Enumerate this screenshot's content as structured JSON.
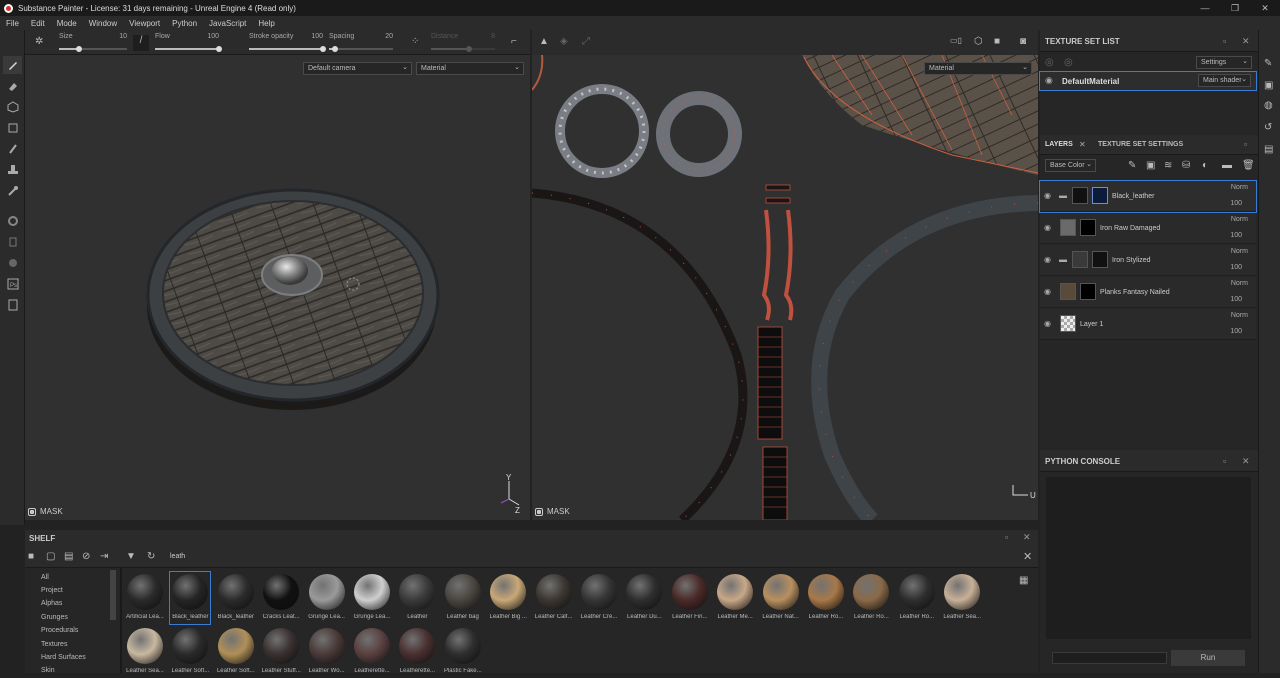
{
  "app": {
    "title": "Substance Painter - License: 31 days remaining - Unreal Engine 4 (Read only)"
  },
  "window_controls": {
    "minimize": "—",
    "restore": "❐",
    "close": "✕"
  },
  "menu": [
    "File",
    "Edit",
    "Mode",
    "Window",
    "Viewport",
    "Python",
    "JavaScript",
    "Help"
  ],
  "brush_params": {
    "size": {
      "label": "Size",
      "value": "10",
      "fraction": 0.3
    },
    "flow": {
      "label": "Flow",
      "value": "100",
      "fraction": 1.0
    },
    "stroke_opacity": {
      "label": "Stroke opacity",
      "value": "100",
      "fraction": 1.0
    },
    "spacing": {
      "label": "Spacing",
      "value": "20",
      "fraction": 0.1
    },
    "distance": {
      "label": "Distance",
      "value": "8",
      "fraction": 0.6
    }
  },
  "viewport3d": {
    "camera": "Default camera",
    "channel": "Material",
    "mask_label": "MASK",
    "axis_y": "Y",
    "axis_z": "Z"
  },
  "viewport2d": {
    "channel": "Material",
    "mask_label": "MASK",
    "axis_u": "U"
  },
  "texture_set_list": {
    "title": "TEXTURE SET LIST",
    "settings_label": "Settings",
    "item_name": "DefaultMaterial",
    "shader": "Main shader"
  },
  "layers_panel": {
    "tab_layers": "LAYERS",
    "tab_settings": "TEXTURE SET SETTINGS",
    "channel": "Base Color",
    "layers": [
      {
        "name": "Black_leather",
        "blend": "Norm",
        "opacity": "100",
        "selected": true,
        "folder": true
      },
      {
        "name": "Iron Raw Damaged",
        "blend": "Norm",
        "opacity": "100",
        "selected": false,
        "folder": false
      },
      {
        "name": "Iron Stylized",
        "blend": "Norm",
        "opacity": "100",
        "selected": false,
        "folder": true
      },
      {
        "name": "Planks Fantasy Nailed",
        "blend": "Norm",
        "opacity": "100",
        "selected": false,
        "folder": false
      },
      {
        "name": "Layer 1",
        "blend": "Norm",
        "opacity": "100",
        "selected": false,
        "folder": false
      }
    ]
  },
  "python_console": {
    "title": "PYTHON CONSOLE",
    "run_label": "Run"
  },
  "shelf": {
    "title": "SHELF",
    "search": "leath",
    "categories": [
      "All",
      "Project",
      "Alphas",
      "Grunges",
      "Procedurals",
      "Textures",
      "Hard Surfaces",
      "Skin"
    ],
    "materials_row1": [
      {
        "name": "Artificial Lea...",
        "color": "#2a2a2a"
      },
      {
        "name": "Black_leather",
        "color": "#252525"
      },
      {
        "name": "Black_leather",
        "color": "#2b2b2b"
      },
      {
        "name": "Cracks Leat...",
        "color": "#111111"
      },
      {
        "name": "Grunge Lea...",
        "color": "#9a9a9a"
      },
      {
        "name": "Grunge Lea...",
        "color": "#cfcfcf"
      },
      {
        "name": "Leather",
        "color": "#3a3a3a"
      },
      {
        "name": "Leather bag",
        "color": "#4a4540"
      },
      {
        "name": "Leather Big ...",
        "color": "#c9a878"
      },
      {
        "name": "Leather Calf...",
        "color": "#3b3630"
      },
      {
        "name": "Leather Cre...",
        "color": "#353535"
      },
      {
        "name": "Leather Du...",
        "color": "#2e2e2e"
      },
      {
        "name": "Leather Fin...",
        "color": "#4a2a28"
      },
      {
        "name": "Leather Me...",
        "color": "#c8a888"
      },
      {
        "name": "Leather Nat...",
        "color": "#b89060"
      },
      {
        "name": "Leather Ro...",
        "color": "#a87848"
      },
      {
        "name": "Leather Ro...",
        "color": "#8a6a48"
      },
      {
        "name": "Leather Ro...",
        "color": "#2e2e2e"
      },
      {
        "name": "Leather Sea...",
        "color": "#c8b098"
      }
    ],
    "materials_row2": [
      {
        "name": "Leather Sea...",
        "color": "#c8b8a0"
      },
      {
        "name": "Leather Soft...",
        "color": "#2a2a2a"
      },
      {
        "name": "Leather Soft...",
        "color": "#b09058"
      },
      {
        "name": "Leather Stuff...",
        "color": "#3a3030"
      },
      {
        "name": "Leather Wo...",
        "color": "#4a3a38"
      },
      {
        "name": "Leatherette...",
        "color": "#5a4040"
      },
      {
        "name": "Leatherette...",
        "color": "#4a3030"
      },
      {
        "name": "Plastic Fake...",
        "color": "#2e2e2e"
      }
    ]
  }
}
